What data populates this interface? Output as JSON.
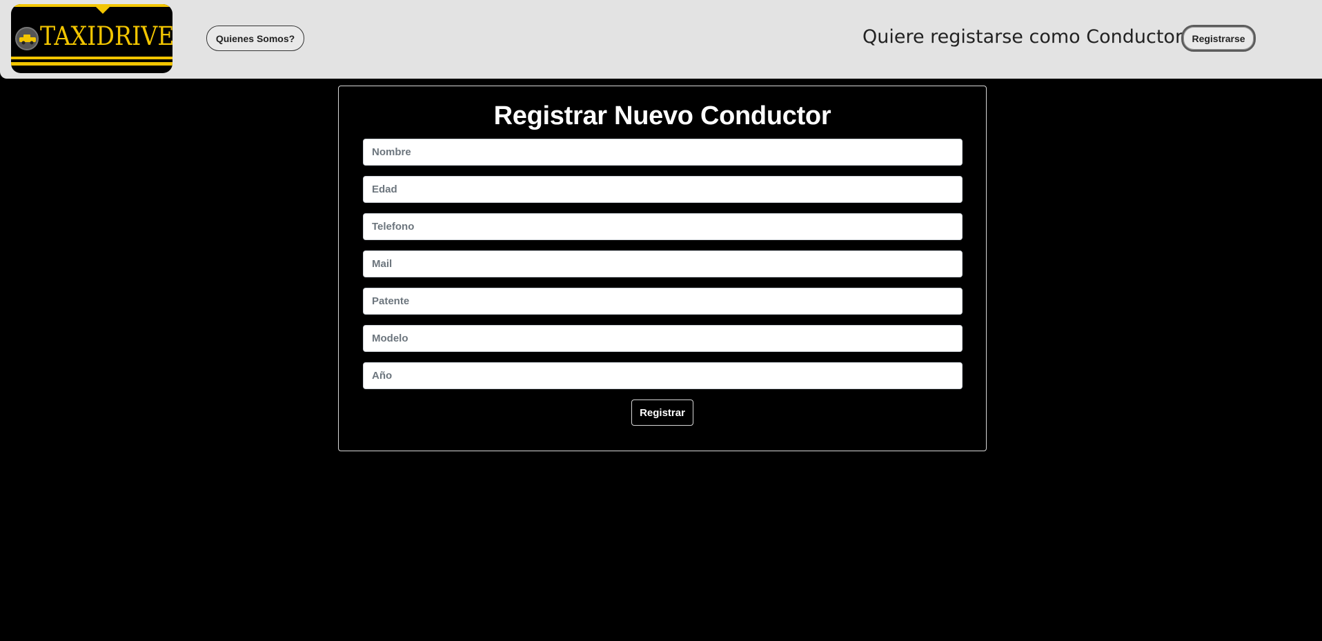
{
  "header": {
    "logo_text": "TAXIDRIVE",
    "about_button": "Quienes Somos?",
    "cta_question": "Quiere registarse como Conductor?",
    "register_button": "Registrarse"
  },
  "form": {
    "title": "Registrar Nuevo Conductor",
    "fields": [
      {
        "placeholder": "Nombre",
        "value": ""
      },
      {
        "placeholder": "Edad",
        "value": ""
      },
      {
        "placeholder": "Telefono",
        "value": ""
      },
      {
        "placeholder": "Mail",
        "value": ""
      },
      {
        "placeholder": "Patente",
        "value": ""
      },
      {
        "placeholder": "Modelo",
        "value": ""
      },
      {
        "placeholder": "Año",
        "value": ""
      }
    ],
    "submit_label": "Registrar"
  },
  "colors": {
    "background": "#000000",
    "navbar": "#e3e3e3",
    "brand_yellow": "#f2c500"
  }
}
